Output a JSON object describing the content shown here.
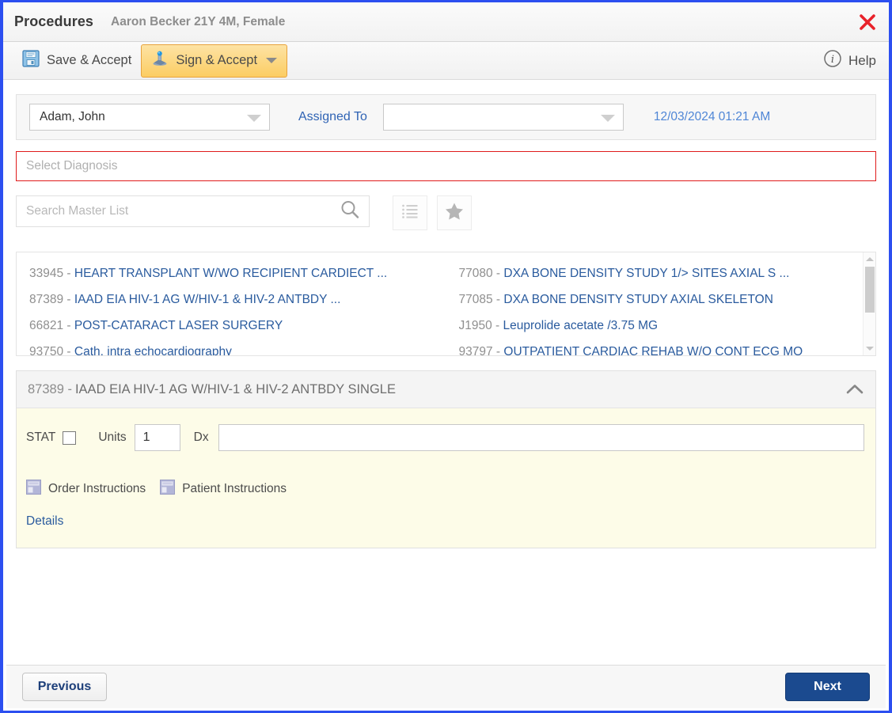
{
  "window": {
    "title": "Procedures",
    "patient": "Aaron Becker 21Y 4M, Female",
    "close_label": "×"
  },
  "toolbar": {
    "save_label": "Save & Accept",
    "sign_label": "Sign & Accept",
    "help_label": "Help"
  },
  "provider_bar": {
    "provider_value": "Adam, John",
    "assigned_to_label": "Assigned To",
    "assigned_to_value": "",
    "timestamp": "12/03/2024 01:21 AM"
  },
  "diagnosis": {
    "placeholder": "Select Diagnosis",
    "value": "",
    "border_color": "#e01b1b"
  },
  "search": {
    "placeholder": "Search Master List",
    "value": "",
    "list_icon": "list-icon",
    "favorite_icon": "star-icon"
  },
  "results": {
    "left": [
      {
        "code": "33945",
        "name": "HEART TRANSPLANT W/WO RECIPIENT CARDIECT ..."
      },
      {
        "code": "87389",
        "name": "IAAD EIA HIV-1 AG W/HIV-1 & HIV-2 ANTBDY ..."
      },
      {
        "code": "66821",
        "name": "POST-CATARACT LASER SURGERY"
      },
      {
        "code": "93750",
        "name": "Cath, intra echocardiography"
      }
    ],
    "right": [
      {
        "code": "77080",
        "name": "DXA BONE DENSITY STUDY 1/> SITES AXIAL S ..."
      },
      {
        "code": "77085",
        "name": "DXA BONE DENSITY STUDY AXIAL SKELETON"
      },
      {
        "code": "J1950",
        "name": "Leuprolide acetate /3.75 MG"
      },
      {
        "code": "93797",
        "name": "OUTPATIENT CARDIAC REHAB W/O CONT ECG MO"
      }
    ]
  },
  "order": {
    "code": "87389 -",
    "title": "IAAD EIA HIV-1 AG W/HIV-1 & HIV-2 ANTBDY SINGLE",
    "stat_label": "STAT",
    "stat_checked": false,
    "units_label": "Units",
    "units_value": "1",
    "dx_label": "Dx",
    "dx_value": "",
    "order_instructions_label": "Order Instructions",
    "patient_instructions_label": "Patient Instructions",
    "details_label": "Details",
    "panel_color": "#fdfce8"
  },
  "footer": {
    "previous_label": "Previous",
    "next_label": "Next",
    "next_color": "#1b4a8f"
  }
}
